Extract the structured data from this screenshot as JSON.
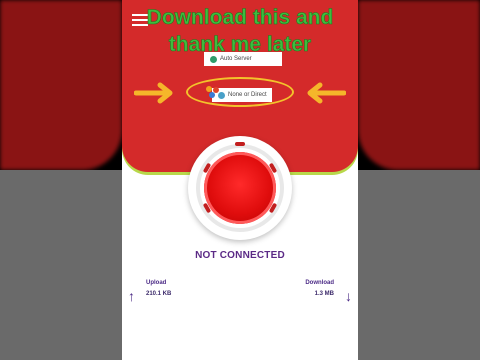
{
  "overlay_text": "Download this and thank me later",
  "servers": [
    {
      "label": "Auto Server"
    },
    {
      "label": "None or Direct"
    }
  ],
  "status": "NOT CONNECTED",
  "upload": {
    "label": "Upload",
    "value": "210.1 KB"
  },
  "download": {
    "label": "Download",
    "value": "1.3 MB"
  },
  "icons": {
    "menu": "hamburger-menu-icon",
    "upload": "arrow-up-icon",
    "download": "arrow-down-icon",
    "connect": "power-icon",
    "arrow": "arrow-pointer-icon"
  },
  "colors": {
    "header": "#d42a2a",
    "overlay_text": "#3ebc3e",
    "highlight": "#f3c32b",
    "arrows": "#f5b62a",
    "status_text": "#5b2a86"
  }
}
